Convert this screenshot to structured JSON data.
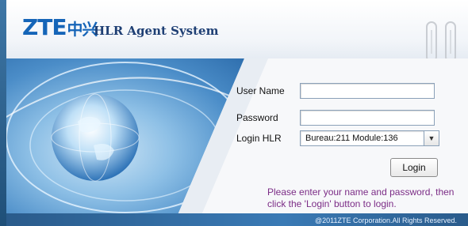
{
  "header": {
    "logo_text": "ZTE",
    "logo_cn": "中兴",
    "title": "HLR Agent System"
  },
  "form": {
    "username_label": "User Name",
    "username_value": "",
    "password_label": "Password",
    "password_value": "",
    "hlr_label": "Login HLR",
    "hlr_selected": "Bureau:211 Module:136",
    "login_button": "Login"
  },
  "hint": "Please enter your name and password, then click the 'Login' button to login.",
  "footer": {
    "copyright": "@2011ZTE Corporation.All Rights Reserved."
  },
  "colors": {
    "brand_blue": "#1565b8",
    "hint_purple": "#7b2c86",
    "footer_blue": "#3a7ab5"
  }
}
